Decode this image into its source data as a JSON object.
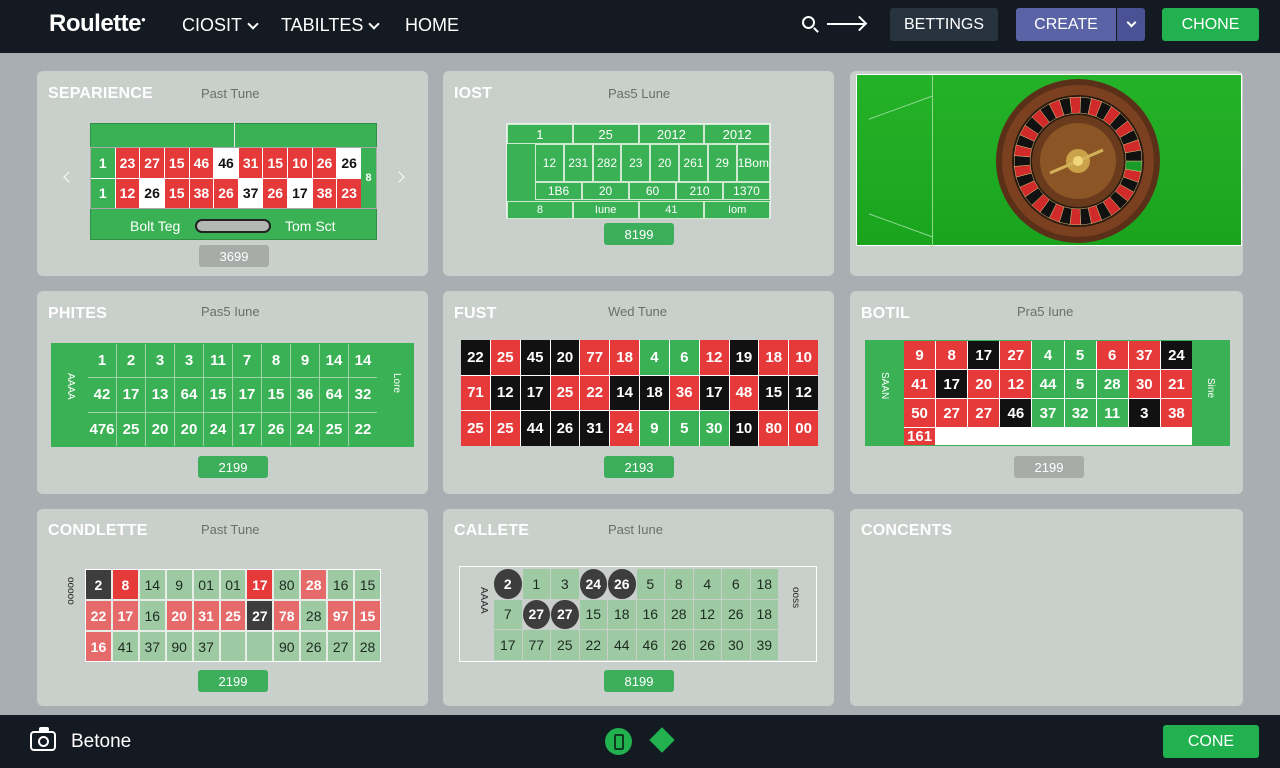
{
  "header": {
    "logo": "Roulette",
    "nav": [
      {
        "label": "CIOSIT",
        "has_dropdown": true
      },
      {
        "label": "TABILTES",
        "has_dropdown": true
      },
      {
        "label": "HOME",
        "has_dropdown": false
      }
    ],
    "buttons": {
      "settings": "BETTINGS",
      "create": "CREATE",
      "chone": "CHONE"
    }
  },
  "cards": {
    "c1": {
      "title": "SEPARIENCE",
      "sub": "Past Tune",
      "bottom_left": "Bolt Teg",
      "bottom_right": "Tom Sct",
      "pill": "3699",
      "rows": [
        [
          "1",
          "23",
          "27",
          "15",
          "46",
          "46",
          "31",
          "15",
          "10",
          "26",
          "26"
        ],
        [
          "1",
          "12",
          "26",
          "15",
          "38",
          "26",
          "37",
          "26",
          "17",
          "38",
          "23"
        ]
      ],
      "side": "8"
    },
    "c2": {
      "title": "IOST",
      "sub": "Pas5 Lune",
      "pill": "8199",
      "header_nums": [
        "1",
        "25",
        "2012",
        "2012"
      ],
      "row1": [
        "12",
        "231",
        "282",
        "23",
        "20",
        "261",
        "29",
        "1Bom"
      ],
      "row2": [
        "1B6",
        "20",
        "60",
        "210",
        "1370"
      ],
      "row3": [
        "8",
        "Iune",
        "41",
        "Iom"
      ]
    },
    "c3": {},
    "c4": {
      "title": "PHITES",
      "sub": "Pas5 Iune",
      "pill": "2199",
      "rows": [
        [
          "1",
          "2",
          "3",
          "3",
          "11",
          "7",
          "8",
          "9",
          "14",
          "14"
        ],
        [
          "42",
          "17",
          "13",
          "64",
          "15",
          "17",
          "15",
          "36",
          "64",
          "32"
        ],
        [
          "476",
          "25",
          "20",
          "20",
          "24",
          "17",
          "26",
          "24",
          "25",
          "22"
        ]
      ]
    },
    "c5": {
      "title": "FUST",
      "sub": "Wed Tune",
      "pill": "2193",
      "rows": [
        [
          "22",
          "25",
          "45",
          "20",
          "77",
          "18",
          "4",
          "6",
          "12",
          "19",
          "18",
          "10"
        ],
        [
          "71",
          "12",
          "17",
          "25",
          "22",
          "14",
          "18",
          "36",
          "17",
          "48",
          "15",
          "12"
        ],
        [
          "25",
          "25",
          "44",
          "26",
          "31",
          "24",
          "9",
          "5",
          "30",
          "10",
          "80",
          "00"
        ]
      ]
    },
    "c6": {
      "title": "BOTIL",
      "sub": "Pra5 Iune",
      "pill": "2199",
      "rows": [
        [
          "9",
          "8",
          "17",
          "27",
          "4",
          "5",
          "6",
          "37",
          "24"
        ],
        [
          "41",
          "17",
          "20",
          "12",
          "44",
          "5",
          "28",
          "30",
          "21"
        ],
        [
          "50",
          "27",
          "27",
          "46",
          "37",
          "32",
          "11",
          "3",
          "38",
          "161"
        ]
      ]
    },
    "c7": {
      "title": "CONDLETTE",
      "sub": "Past Tune",
      "pill": "2199",
      "rows": [
        [
          "2",
          "8",
          "14",
          "9",
          "01",
          "01",
          "17",
          "80",
          "28",
          "16",
          "15"
        ],
        [
          "22",
          "17",
          "16",
          "20",
          "31",
          "25",
          "27",
          "78",
          "28",
          "97",
          "15"
        ],
        [
          "16",
          "41",
          "37",
          "90",
          "37",
          "",
          "",
          "90",
          "26",
          "27",
          "28"
        ]
      ]
    },
    "c8": {
      "title": "CALLETE",
      "sub": "Past Iune",
      "pill": "8199",
      "rows": [
        [
          "2",
          "1",
          "3",
          "24",
          "26",
          "5",
          "8",
          "4",
          "6",
          "18"
        ],
        [
          "7",
          "27",
          "27",
          "15",
          "18",
          "16",
          "28",
          "12",
          "26",
          "18"
        ],
        [
          "17",
          "77",
          "25",
          "22",
          "44",
          "46",
          "26",
          "26",
          "30",
          "39"
        ]
      ]
    },
    "c9": {
      "title": "CONCENTS"
    }
  },
  "footer": {
    "label": "Betone",
    "button": "CONE"
  },
  "icons": [
    "camera-icon",
    "phone-icon",
    "diamond-icon",
    "search-icon",
    "arrow-right-icon",
    "chevron-down-icon",
    "roulette-wheel-icon"
  ],
  "colors": {
    "topbar": "#141a22",
    "green": "#21b14f",
    "red": "#e63a3a",
    "black": "#111111",
    "create": "#5a63a6"
  }
}
